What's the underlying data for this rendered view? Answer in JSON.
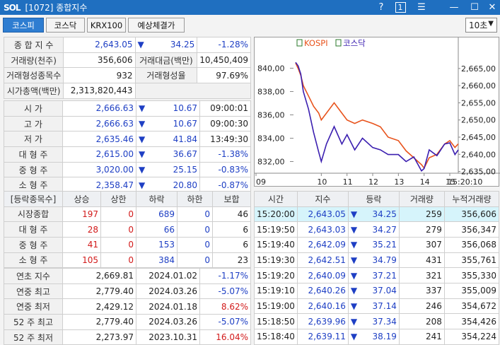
{
  "window": {
    "logo": "SOL",
    "title": "[1072] 종합지수",
    "help": "?",
    "count": "1"
  },
  "tabs": [
    {
      "label": "코스피",
      "active": true
    },
    {
      "label": "코스닥",
      "active": false
    },
    {
      "label": "KRX100",
      "active": false
    },
    {
      "label": "예상체결가",
      "active": false
    }
  ],
  "interval": "10초",
  "summary": {
    "index_label": "종 합 지 수",
    "index_value": "2,643.05",
    "index_change": "34.25",
    "index_pct": "-1.28%",
    "volume_label": "거래량(천주)",
    "volume": "356,606",
    "amount_label": "거래대금(백만)",
    "amount": "10,450,409",
    "formed_label": "거래형성종목수",
    "formed": "932",
    "formed_rate_label": "거래형성율",
    "formed_rate": "97.69%",
    "cap_label": "시가총액(백만)",
    "cap": "2,313,820,443"
  },
  "prices": [
    {
      "label": "시   가",
      "value": "2,666.63",
      "diff": "10.67",
      "extra": "09:00:01"
    },
    {
      "label": "고   가",
      "value": "2,666.63",
      "diff": "10.67",
      "extra": "09:00:30"
    },
    {
      "label": "저   가",
      "value": "2,635.46",
      "diff": "41.84",
      "extra": "13:49:30"
    },
    {
      "label": "대 형 주",
      "value": "2,615.00",
      "diff": "36.67",
      "extra": "-1.38%"
    },
    {
      "label": "중 형 주",
      "value": "3,020.00",
      "diff": "25.15",
      "extra": "-0.83%"
    },
    {
      "label": "소 형 주",
      "value": "2,358.47",
      "diff": "20.80",
      "extra": "-0.87%"
    }
  ],
  "updown": {
    "headers": [
      "[등락종목수]",
      "상승",
      "상한",
      "하락",
      "하한",
      "보합"
    ],
    "rows": [
      {
        "label": "시장종합",
        "up": "197",
        "uplim": "0",
        "down": "689",
        "downlim": "0",
        "flat": "46"
      },
      {
        "label": "대 형 주",
        "up": "28",
        "uplim": "0",
        "down": "66",
        "downlim": "0",
        "flat": "6"
      },
      {
        "label": "중 형 주",
        "up": "41",
        "uplim": "0",
        "down": "153",
        "downlim": "0",
        "flat": "6"
      },
      {
        "label": "소 형 주",
        "up": "105",
        "uplim": "0",
        "down": "384",
        "downlim": "0",
        "flat": "23"
      }
    ]
  },
  "yearly": [
    {
      "label": "연초  지수",
      "value": "2,669.81",
      "date": "2024.01.02",
      "pct": "-1.17%",
      "color": "blue"
    },
    {
      "label": "연중  최고",
      "value": "2,779.40",
      "date": "2024.03.26",
      "pct": "-5.07%",
      "color": "blue"
    },
    {
      "label": "연중  최저",
      "value": "2,429.12",
      "date": "2024.01.18",
      "pct": "8.62%",
      "color": "red"
    },
    {
      "label": "52 주 최고",
      "value": "2,779.40",
      "date": "2024.03.26",
      "pct": "-5.07%",
      "color": "blue"
    },
    {
      "label": "52 주 최저",
      "value": "2,273.97",
      "date": "2023.10.31",
      "pct": "16.04%",
      "color": "red"
    }
  ],
  "ticks": {
    "headers": [
      "시간",
      "지수",
      "등락",
      "거래량",
      "누적거래량"
    ],
    "rows": [
      {
        "time": "15:20:00",
        "index": "2,643.05",
        "chg": "34.25",
        "vol": "259",
        "cum": "356,606"
      },
      {
        "time": "15:19:50",
        "index": "2,643.03",
        "chg": "34.27",
        "vol": "279",
        "cum": "356,347"
      },
      {
        "time": "15:19:40",
        "index": "2,642.09",
        "chg": "35.21",
        "vol": "307",
        "cum": "356,068"
      },
      {
        "time": "15:19:30",
        "index": "2,642.51",
        "chg": "34.79",
        "vol": "431",
        "cum": "355,761"
      },
      {
        "time": "15:19:20",
        "index": "2,640.09",
        "chg": "37.21",
        "vol": "321",
        "cum": "355,330"
      },
      {
        "time": "15:19:10",
        "index": "2,640.26",
        "chg": "37.04",
        "vol": "337",
        "cum": "355,009"
      },
      {
        "time": "15:19:00",
        "index": "2,640.16",
        "chg": "37.14",
        "vol": "246",
        "cum": "354,672"
      },
      {
        "time": "15:18:50",
        "index": "2,639.96",
        "chg": "37.34",
        "vol": "208",
        "cum": "354,426"
      },
      {
        "time": "15:18:40",
        "index": "2,639.11",
        "chg": "38.19",
        "vol": "241",
        "cum": "354,224"
      }
    ]
  },
  "chart_data": {
    "type": "line",
    "legend": [
      "KOSPI",
      "코스닥"
    ],
    "x_ticks": [
      "09",
      "10",
      "11",
      "12",
      "13",
      "14",
      "15"
    ],
    "end_label": "15:20:10",
    "y_left": {
      "ticks": [
        "840,00",
        "838,00",
        "836,00",
        "834,00",
        "832,00"
      ],
      "range": [
        831,
        841.3
      ]
    },
    "y_right": {
      "ticks": [
        "2,665,00",
        "2,660,00",
        "2,655,00",
        "2,650,00",
        "2,645,00",
        "2,640,00",
        "2,635,00"
      ],
      "range": [
        2634.5,
        2669.5
      ]
    },
    "series": [
      {
        "name": "KOSPI",
        "axis": "right",
        "color": "#e8531c",
        "x": [
          9.0,
          9.1,
          9.2,
          9.3,
          9.5,
          9.7,
          9.9,
          10.0,
          10.2,
          10.5,
          10.8,
          11.0,
          11.3,
          11.6,
          12.0,
          12.3,
          12.6,
          13.0,
          13.3,
          13.6,
          13.9,
          14.0,
          14.2,
          14.5,
          14.8,
          15.0,
          15.2,
          15.33
        ],
        "values": [
          2666.6,
          2665,
          2663,
          2660,
          2657,
          2654,
          2652,
          2650,
          2652,
          2655,
          2652,
          2650,
          2649,
          2650,
          2649,
          2648,
          2645,
          2644,
          2641,
          2639,
          2637,
          2636,
          2639,
          2640,
          2643,
          2644,
          2642,
          2643.05
        ]
      },
      {
        "name": "코스닥",
        "axis": "left",
        "color": "#3b1fb0",
        "x": [
          9.0,
          9.1,
          9.2,
          9.3,
          9.5,
          9.7,
          9.9,
          10.0,
          10.2,
          10.5,
          10.8,
          11.0,
          11.3,
          11.6,
          12.0,
          12.3,
          12.6,
          13.0,
          13.3,
          13.6,
          13.9,
          14.0,
          14.2,
          14.5,
          14.8,
          15.0,
          15.2,
          15.33
        ],
        "values": [
          840.5,
          840.2,
          839.5,
          838.0,
          836.5,
          834.5,
          832.8,
          832.0,
          833.5,
          835.0,
          833.5,
          834.3,
          833.0,
          834.0,
          833.2,
          833.0,
          832.6,
          832.6,
          832.0,
          832.4,
          831.2,
          831.4,
          833.0,
          832.5,
          833.5,
          833.6,
          832.6,
          833.0
        ]
      }
    ]
  }
}
